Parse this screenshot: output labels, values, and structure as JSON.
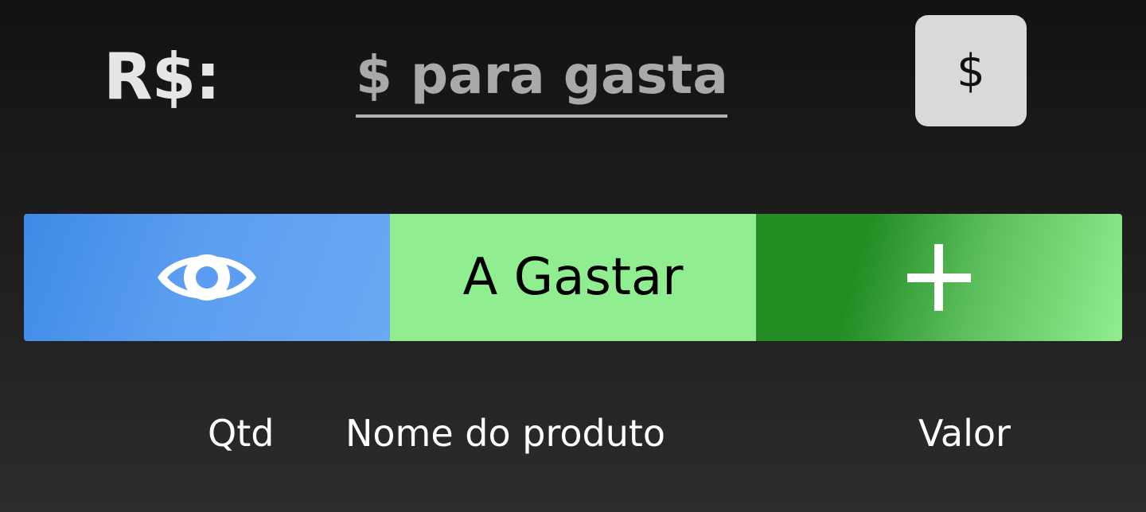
{
  "header": {
    "currency_label": "R$:",
    "budget_input": {
      "value": "",
      "placeholder": "$ para gastar"
    },
    "dollar_button_label": "$"
  },
  "actions": {
    "view": {
      "icon": "eye-icon",
      "color": "#4a90e2"
    },
    "spend": {
      "label": "A Gastar",
      "color": "#90ee90"
    },
    "add": {
      "icon": "plus-icon",
      "color": "#228b22"
    }
  },
  "table": {
    "columns": [
      "Qtd",
      "Nome do produto",
      "Valor"
    ]
  }
}
